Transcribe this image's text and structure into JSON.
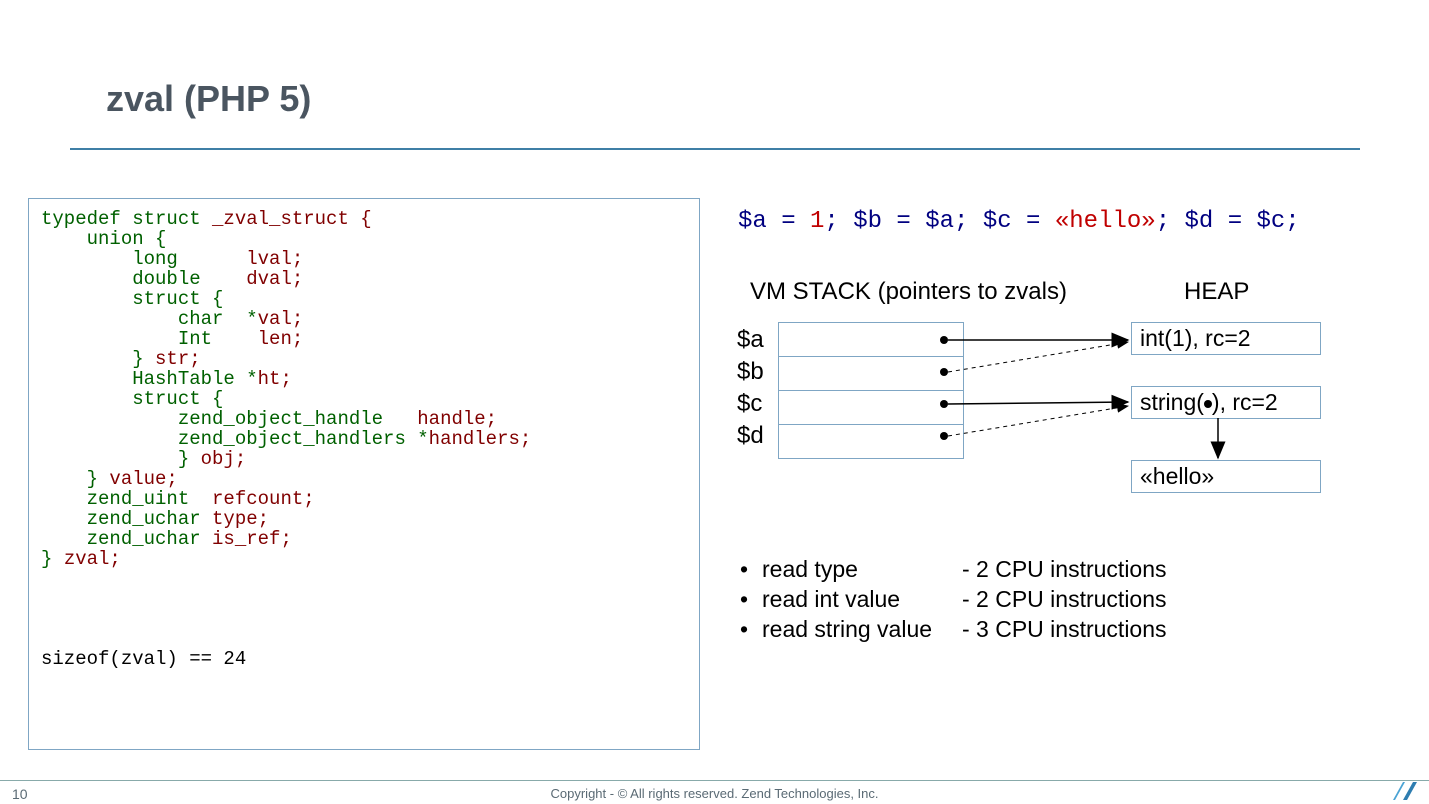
{
  "title": "zval (PHP 5)",
  "code": {
    "l1a": "typedef struct ",
    "l1b": "_zval_struct {",
    "l2": "    union {",
    "l3a": "        long      ",
    "l3b": "lval;",
    "l4a": "        double    ",
    "l4b": "dval;",
    "l5": "        struct {",
    "l6a": "            char  *",
    "l6b": "val;",
    "l7a": "            Int    ",
    "l7b": "len;",
    "l8a": "        } ",
    "l8b": "str;",
    "l9a": "        HashTable *",
    "l9b": "ht;",
    "l10": "        struct {",
    "l11a": "            zend_object_handle   ",
    "l11b": "handle;",
    "l12a": "            zend_object_handlers *",
    "l12b": "handlers;",
    "l13a": "            } ",
    "l13b": "obj;",
    "l14a": "    } ",
    "l14b": "value;",
    "l15a": "    zend_uint  ",
    "l15b": "refcount;",
    "l16a": "    zend_uchar ",
    "l16b": "type;",
    "l17a": "    zend_uchar ",
    "l17b": "is_ref;",
    "l18a": "} ",
    "l18b": "zval;",
    "sizeof": "sizeof(zval) == 24"
  },
  "php": {
    "p1": "$a = ",
    "p2": "1",
    "p3": "; $b = $a; $c = ",
    "p4": "«hello»",
    "p5": "; $d = $c;"
  },
  "labels": {
    "stack": "VM STACK (pointers to zvals)",
    "heap": "HEAP"
  },
  "vars": {
    "a": "$a",
    "b": "$b",
    "c": "$c",
    "d": "$d"
  },
  "heap": {
    "int": "int(1), rc=2",
    "str_a": "string(",
    "str_b": "), rc=2",
    "hello": "«hello»"
  },
  "bullets": {
    "r1l": "read type",
    "r1r": "- 2 CPU instructions",
    "r2l": "read int value",
    "r2r": "- 2 CPU instructions",
    "r3l": "read string value",
    "r3r": "- 3 CPU instructions"
  },
  "footer": {
    "page": "10",
    "copyright": "Copyright - © All rights reserved. Zend Technologies, Inc."
  }
}
